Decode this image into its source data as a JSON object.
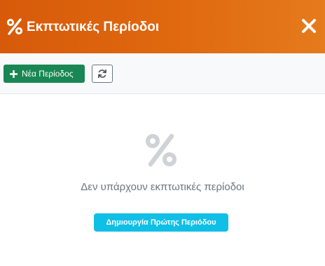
{
  "header": {
    "title": "Εκπτωτικές Περίοδοι",
    "icon": "percent-icon",
    "close_icon": "close-icon"
  },
  "toolbar": {
    "new_label": "Νέα Περίοδος",
    "new_icon": "plus-icon",
    "refresh_icon": "refresh-icon"
  },
  "empty_state": {
    "icon": "percent-icon",
    "message": "Δεν υπάρχουν εκπτωτικές περίοδοι",
    "create_label": "Δημιουργία Πρώτης Περιόδου"
  },
  "colors": {
    "header_start": "#d75a0a",
    "header_end": "#e57b1d",
    "new_button": "#198754",
    "create_button": "#10bfe6",
    "empty_icon": "#cfd3d8",
    "empty_text": "#6c757d"
  }
}
